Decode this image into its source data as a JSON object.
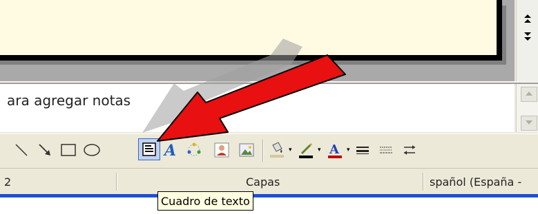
{
  "notes": {
    "text": "ara agregar notas"
  },
  "toolbar": {
    "tools": [
      {
        "name": "line",
        "icon": "line-icon"
      },
      {
        "name": "arrow",
        "icon": "arrow-icon"
      },
      {
        "name": "rectangle",
        "icon": "rectangle-icon"
      },
      {
        "name": "oval",
        "icon": "oval-icon"
      },
      {
        "name": "text-box",
        "icon": "text-box-icon",
        "state": "selected"
      },
      {
        "name": "wordart",
        "icon": "wordart-icon"
      },
      {
        "name": "diagram",
        "icon": "diagram-icon"
      },
      {
        "name": "clip-art",
        "icon": "clip-art-icon"
      },
      {
        "name": "picture",
        "icon": "picture-icon"
      },
      {
        "name": "fill-color",
        "icon": "fill-color-icon"
      },
      {
        "name": "line-color",
        "icon": "line-color-icon"
      },
      {
        "name": "font-color",
        "icon": "font-color-icon"
      },
      {
        "name": "line-style",
        "icon": "line-style-icon"
      },
      {
        "name": "dash-style",
        "icon": "dash-style-icon"
      },
      {
        "name": "arrow-style",
        "icon": "arrow-style-icon"
      }
    ],
    "font_color_glyph": "A",
    "wordart_glyph": "A",
    "dropdown_glyph": "▾"
  },
  "status": {
    "slide_fragment": "2",
    "design": "Capas",
    "language": "spañol (España -"
  },
  "tooltip": {
    "text": "Cuadro de texto"
  },
  "colors": {
    "slide_background": "#fffbe3",
    "highlight_arrow": "#e81010",
    "taskbar": "#1d4fd8",
    "tooltip_background": "#ffffe1"
  }
}
